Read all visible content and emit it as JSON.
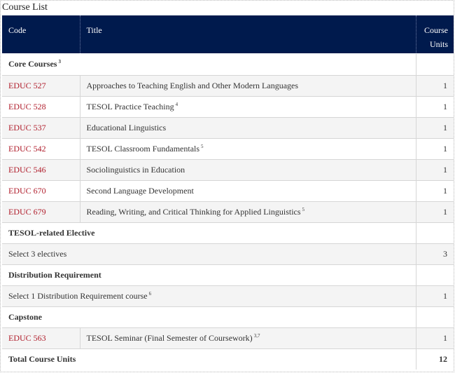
{
  "caption": "Course List",
  "columns": {
    "code": "Code",
    "title": "Title",
    "units_line1": "Course",
    "units_line2": "Units"
  },
  "sections": {
    "core": {
      "label": "Core Courses",
      "note": "3"
    },
    "elective": {
      "label": "TESOL-related Elective"
    },
    "distribution": {
      "label": "Distribution Requirement"
    },
    "capstone": {
      "label": "Capstone"
    }
  },
  "courses": [
    {
      "code": "EDUC 527",
      "title": "Approaches to Teaching English and Other Modern Languages",
      "note": "",
      "units": "1"
    },
    {
      "code": "EDUC 528",
      "title": "TESOL Practice Teaching",
      "note": "4",
      "units": "1"
    },
    {
      "code": "EDUC 537",
      "title": "Educational Linguistics",
      "note": "",
      "units": "1"
    },
    {
      "code": "EDUC 542",
      "title": "TESOL Classroom Fundamentals",
      "note": "5",
      "units": "1"
    },
    {
      "code": "EDUC 546",
      "title": "Sociolinguistics in Education",
      "note": "",
      "units": "1"
    },
    {
      "code": "EDUC 670",
      "title": "Second Language Development",
      "note": "",
      "units": "1"
    },
    {
      "code": "EDUC 679",
      "title": "Reading, Writing, and Critical Thinking for Applied Linguistics",
      "note": "5",
      "units": "1"
    }
  ],
  "elective_row": {
    "text": "Select 3 electives",
    "units": "3"
  },
  "distribution_row": {
    "text": "Select 1 Distribution Requirement course",
    "note": "6",
    "units": "1"
  },
  "capstone_course": {
    "code": "EDUC 563",
    "title": "TESOL Seminar (Final Semester of Coursework)",
    "note": "3,7",
    "units": "1"
  },
  "total": {
    "label": "Total Course Units",
    "units": "12"
  },
  "colors": {
    "header_bg": "#001a4d",
    "link": "#b01e2c",
    "row_alt": "#f4f4f4"
  }
}
